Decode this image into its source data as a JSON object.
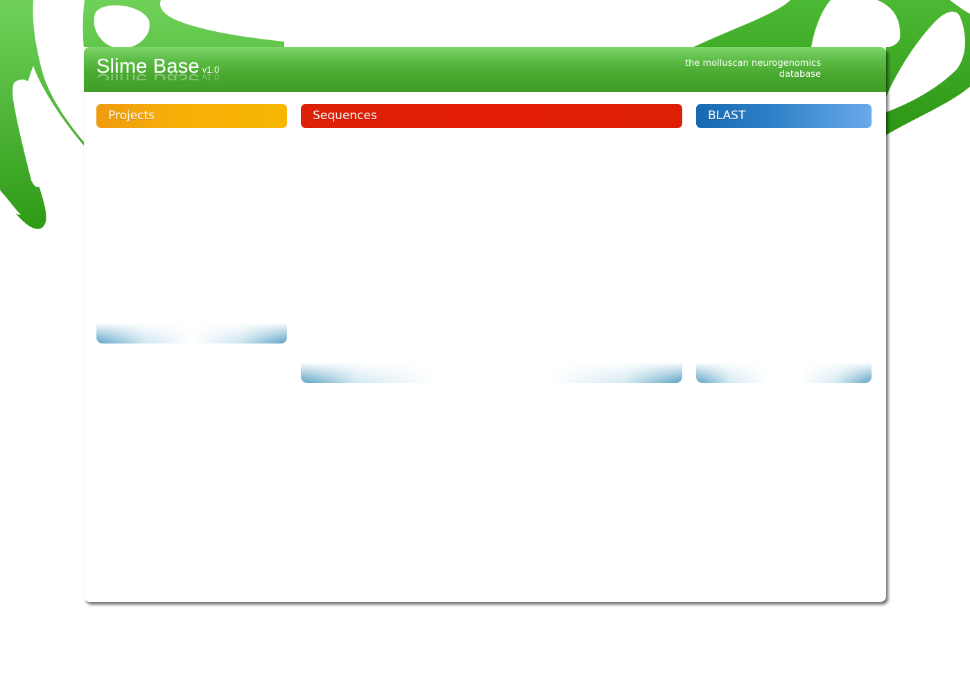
{
  "header": {
    "title": "Slime Base",
    "version": "v1.0",
    "tagline_line1": "the molluscan neurogenomics",
    "tagline_line2": "database"
  },
  "sections": {
    "projects": {
      "title": "Projects"
    },
    "sequences": {
      "title": "Sequences"
    },
    "blast": {
      "title": "BLAST"
    }
  },
  "colors": {
    "brand_green": "#48a82f",
    "projects_orange": "#f6ae08",
    "sequences_red": "#e31e05",
    "blast_blue": "#2f82c7"
  }
}
